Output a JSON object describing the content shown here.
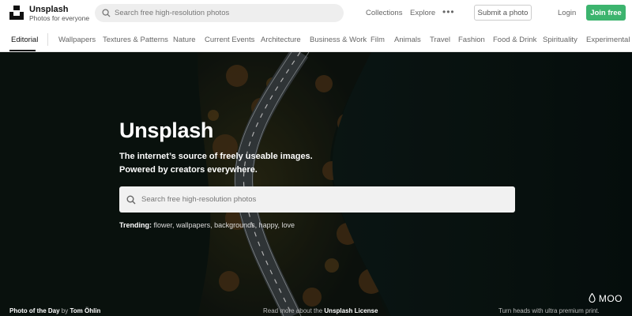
{
  "header": {
    "brand_name": "Unsplash",
    "brand_tagline": "Photos for everyone",
    "search_placeholder": "Search free high-resolution photos",
    "nav": [
      "Collections",
      "Explore"
    ],
    "more_icon": "ellipsis-icon",
    "submit_label": "Submit a photo",
    "login_label": "Login",
    "join_label": "Join free"
  },
  "categories": {
    "active": "Editorial",
    "items": [
      "Editorial",
      "Wallpapers",
      "Textures & Patterns",
      "Nature",
      "Current Events",
      "Architecture",
      "Business & Work",
      "Film",
      "Animals",
      "Travel",
      "Fashion",
      "Food & Drink",
      "Spirituality",
      "Experimental"
    ]
  },
  "hero": {
    "title": "Unsplash",
    "subtitle_line1": "The internet’s source of freely useable images.",
    "subtitle_line2": "Powered by creators everywhere.",
    "search_placeholder": "Search free high-resolution photos",
    "trending_label": "Trending:",
    "trending_items": [
      "flower",
      "wallpapers",
      "backgrounds",
      "happy",
      "love"
    ],
    "photo_of_day_label": "Photo of the Day",
    "photo_by": "by",
    "photographer": "Tom Öhlin",
    "license_prefix": "Read more about the",
    "license_link": "Unsplash License",
    "sponsor_logo": "MOO",
    "sponsor_tagline": "Turn heads with ultra premium print."
  },
  "colors": {
    "join_button": "#3cb46e",
    "hero_dark": "#0b1210",
    "search_bg": "#eeeeee"
  }
}
